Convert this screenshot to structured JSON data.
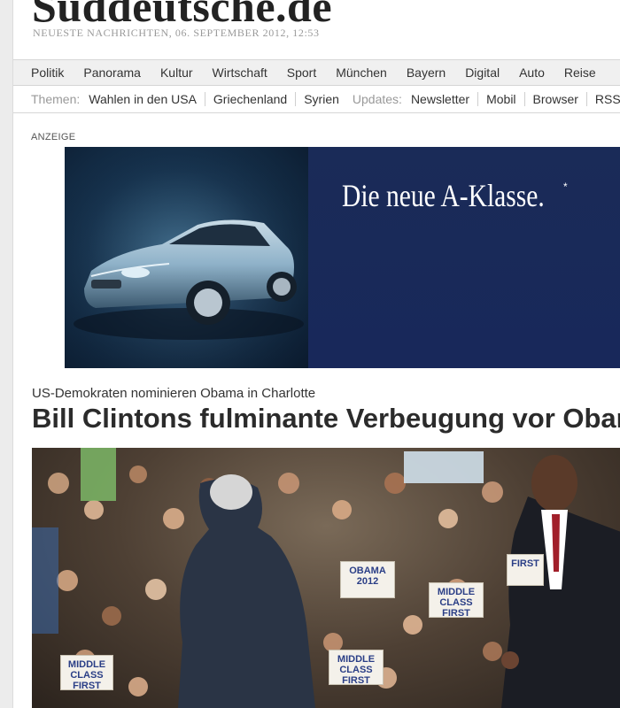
{
  "site": {
    "masthead": "Süddeutsche.de",
    "dateline": "NEUESTE NACHRICHTEN, 06. SEPTEMBER 2012, 12:53"
  },
  "nav": {
    "primary": [
      "Politik",
      "Panorama",
      "Kultur",
      "Wirtschaft",
      "Sport",
      "München",
      "Bayern",
      "Digital",
      "Auto",
      "Reise"
    ],
    "themes_label": "Themen:",
    "themes": [
      "Wahlen in den USA",
      "Griechenland",
      "Syrien"
    ],
    "updates_label": "Updates:",
    "updates": [
      "Newsletter",
      "Mobil",
      "Browser",
      "RSS"
    ]
  },
  "ad": {
    "label": "ANZEIGE",
    "slogan": "Die neue A-Klasse.",
    "asterisk": "*",
    "colors": {
      "panel": "#1a2b58",
      "photo_bg": "#16334f",
      "car": "#8fb2c9"
    }
  },
  "article": {
    "kicker": "US-Demokraten nominieren Obama in Charlotte",
    "headline": "Bill Clintons fulminante Verbeugung vor Obama",
    "photo_signs": [
      "OBAMA 2012",
      "MIDDLE CLASS FIRST",
      "MIDDLE CLASS FIRST",
      "MIDDLE CLASS FIRST",
      "FIRST"
    ]
  }
}
